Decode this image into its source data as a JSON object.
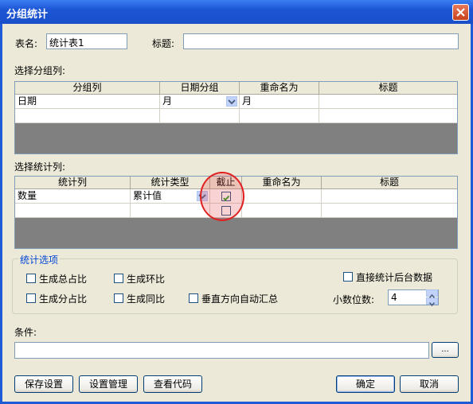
{
  "window": {
    "title": "分组统计"
  },
  "table_name": {
    "label": "表名:",
    "value": "统计表1"
  },
  "title_field": {
    "label": "标题:",
    "value": ""
  },
  "group_section": {
    "label": "选择分组列:",
    "columns": [
      "分组列",
      "日期分组",
      "重命名为",
      "标题"
    ],
    "rows": [
      {
        "col": "日期",
        "date_group": "月",
        "rename": "月",
        "title": ""
      }
    ]
  },
  "stat_section": {
    "label": "选择统计列:",
    "columns": [
      "统计列",
      "统计类型",
      "截止",
      "重命名为",
      "标题"
    ],
    "rows": [
      {
        "col": "数量",
        "type": "累计值",
        "cutoff": true,
        "rename": "",
        "title": ""
      },
      {
        "col": "",
        "type": "",
        "cutoff": false,
        "rename": "",
        "title": ""
      }
    ]
  },
  "options": {
    "title": "统计选项",
    "total_ratio": "生成总占比",
    "ring_ratio": "生成环比",
    "direct_stat": "直接统计后台数据",
    "group_ratio": "生成分占比",
    "yoy_ratio": "生成同比",
    "vertical_sum": "垂直方向自动汇总",
    "decimal_label": "小数位数:",
    "decimal_value": "4"
  },
  "condition": {
    "label": "条件:",
    "value": "",
    "browse": "..."
  },
  "buttons": {
    "save": "保存设置",
    "manage": "设置管理",
    "view_code": "查看代码",
    "ok": "确定",
    "cancel": "取消"
  },
  "colors": {
    "titlebar": "#1c55d4",
    "highlight": "#e02020",
    "group_title": "#0046d5"
  }
}
